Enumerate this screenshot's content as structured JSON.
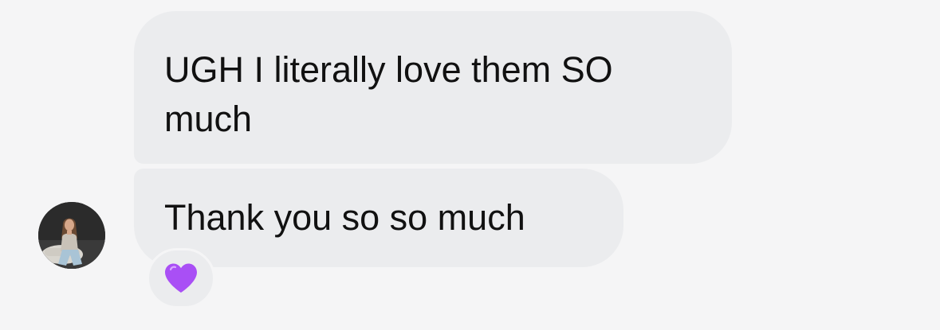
{
  "thread": {
    "messages": [
      {
        "text": "UGH I literally love them SO much"
      },
      {
        "text": "Thank you so so much"
      }
    ],
    "reaction": {
      "icon": "purple-heart-icon",
      "color": "#a94ff5"
    },
    "colors": {
      "background": "#f5f5f6",
      "bubble": "#ebecee",
      "text": "#111111"
    }
  }
}
